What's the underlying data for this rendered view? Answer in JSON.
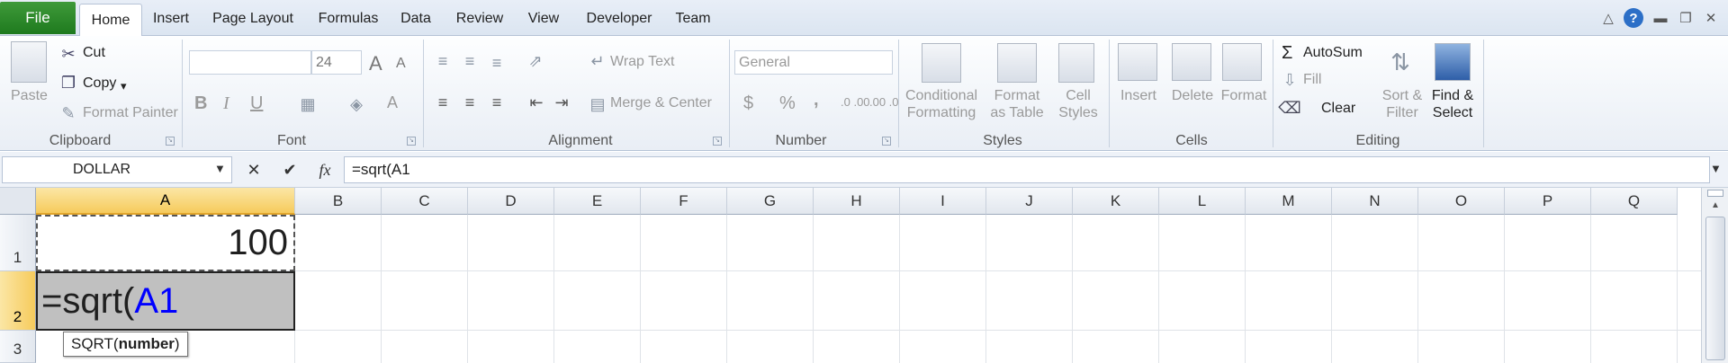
{
  "tabs": {
    "file": "File",
    "items": [
      "Home",
      "Insert",
      "Page Layout",
      "Formulas",
      "Data",
      "Review",
      "View",
      "Developer",
      "Team"
    ]
  },
  "ribbon": {
    "clipboard": {
      "paste": "Paste",
      "cut": "Cut",
      "copy": "Copy",
      "format_painter": "Format Painter",
      "label": "Clipboard"
    },
    "font": {
      "font_name": "",
      "font_size": "24",
      "bold": "B",
      "italic": "I",
      "underline": "U",
      "grow": "A",
      "shrink": "A",
      "color": "A",
      "label": "Font"
    },
    "alignment": {
      "wrap_text": "Wrap Text",
      "merge_center": "Merge & Center",
      "label": "Alignment"
    },
    "number": {
      "format": "General",
      "currency": "$",
      "percent": "%",
      "comma": ",",
      "inc_decimal": ".0 .00",
      "dec_decimal": ".00 .0",
      "label": "Number"
    },
    "styles": {
      "conditional": [
        "Conditional",
        "Formatting"
      ],
      "format_table": [
        "Format",
        "as Table"
      ],
      "cell_styles": [
        "Cell",
        "Styles"
      ],
      "label": "Styles"
    },
    "cells": {
      "insert": "Insert",
      "delete": "Delete",
      "format": "Format",
      "label": "Cells"
    },
    "editing": {
      "autosum": "AutoSum",
      "fill": "Fill",
      "clear": "Clear",
      "sort_filter": [
        "Sort &",
        "Filter"
      ],
      "find_select": [
        "Find &",
        "Select"
      ],
      "label": "Editing"
    }
  },
  "formula_bar": {
    "name_box": "DOLLAR",
    "formula": "=sqrt(A1"
  },
  "grid": {
    "columns": [
      "A",
      "B",
      "C",
      "D",
      "E",
      "F",
      "G",
      "H",
      "I",
      "J",
      "K",
      "L",
      "M",
      "N",
      "O",
      "P",
      "Q"
    ],
    "rows": [
      "1",
      "2",
      "3"
    ],
    "a1_value": "100",
    "a2_prefix": "=sqrt(",
    "a2_ref": "A1",
    "tooltip_func": "SQRT(",
    "tooltip_arg": "number",
    "tooltip_close": ")"
  },
  "colors": {
    "ref_blue": "#0000ff",
    "file_green": "#2a8a2a",
    "selected_header": "#f6cb5c"
  }
}
